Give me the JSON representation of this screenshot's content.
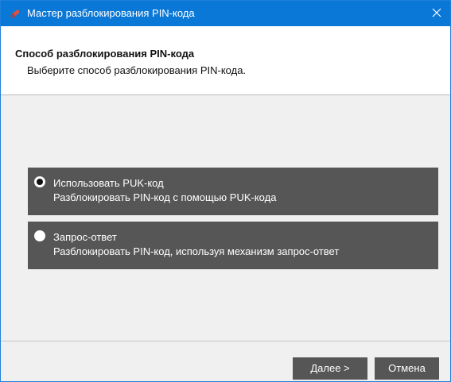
{
  "window": {
    "title": "Мастер разблокирования PIN-кода",
    "title_icon": "red-key-icon",
    "close_icon": "close-icon",
    "titlebar_color": "#0a78d7"
  },
  "header": {
    "title": "Способ разблокирования PIN-кода",
    "subtitle": "Выберите способ разблокирования PIN-кода."
  },
  "options": [
    {
      "title": "Использовать PUK-код",
      "description": "Разблокировать PIN-код с помощью PUK-кода",
      "selected": true
    },
    {
      "title": "Запрос-ответ",
      "description": "Разблокировать PIN-код, используя механизм запрос-ответ",
      "selected": false
    }
  ],
  "buttons": {
    "next": "Далее >",
    "cancel": "Отмена"
  },
  "colors": {
    "option_bg": "#565656",
    "content_bg": "#f0f0f0",
    "button_bg": "#565656"
  }
}
